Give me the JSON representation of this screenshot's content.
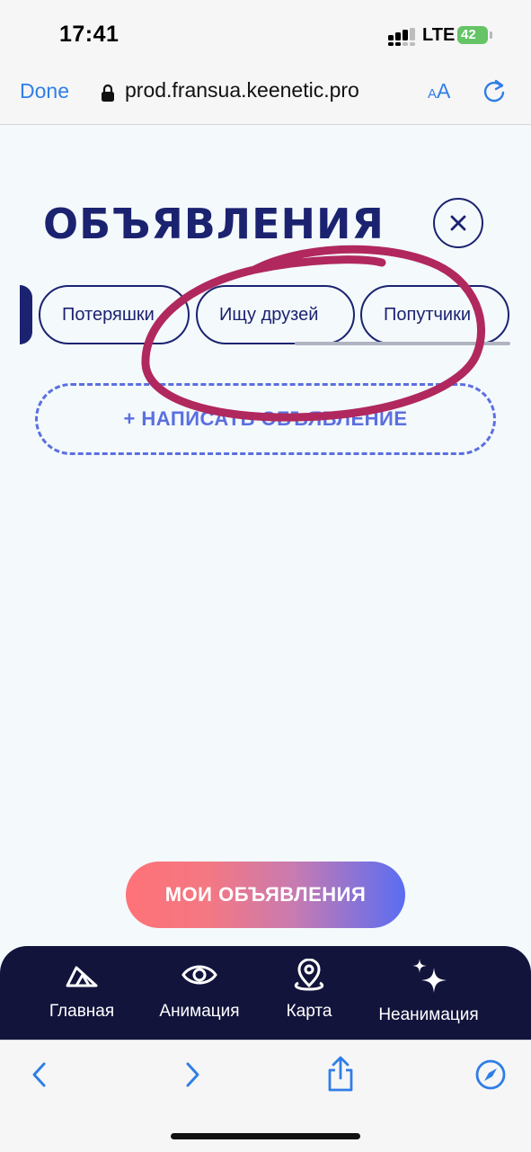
{
  "status_bar": {
    "time": "17:41",
    "network": "LTE",
    "battery": "42"
  },
  "browser": {
    "done_label": "Done",
    "url": "prod.fransua.keenetic.pro",
    "text_size_small": "A",
    "text_size_big": "A"
  },
  "page": {
    "title": "ОБЪЯВЛЕНИЯ",
    "tabs": [
      {
        "label": "Потеряшки"
      },
      {
        "label": "Ищу друзей"
      },
      {
        "label": "Попутчики"
      }
    ],
    "write_button": "+ НАПИСАТЬ ОБЪЯВЛЕНИЕ",
    "my_ads_button": "МОИ ОБЪЯВЛЕНИЯ"
  },
  "bottom_nav": {
    "items": [
      {
        "label": "Главная",
        "icon": "home-triangle-icon"
      },
      {
        "label": "Анимация",
        "icon": "eye-icon"
      },
      {
        "label": "Карта",
        "icon": "map-pin-icon"
      },
      {
        "label": "Неанимация",
        "icon": "sparkle-icon"
      }
    ]
  },
  "colors": {
    "primary": "#1b2370",
    "accent_dashed": "#5a6fe0",
    "nav_bg": "#12143c",
    "annotation": "#b0285e",
    "ios_blue": "#2f7ee6"
  }
}
